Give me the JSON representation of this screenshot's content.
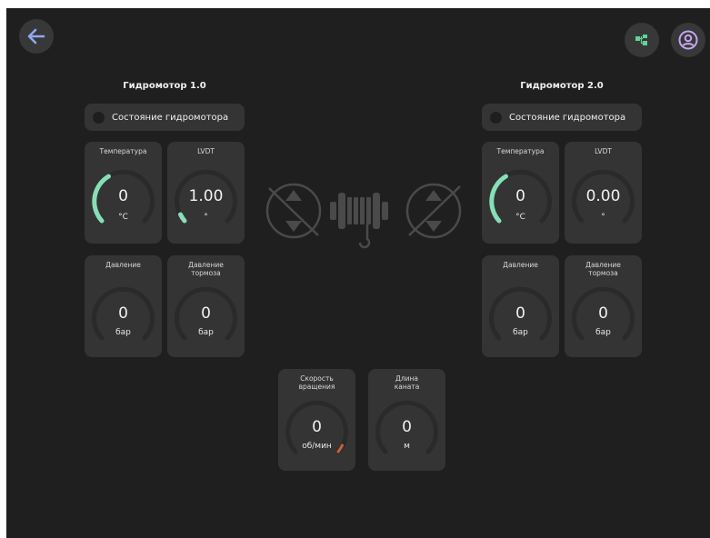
{
  "colors": {
    "background": "#1f1f1f",
    "card": "#343434",
    "gauge_track": "#2a2a2a",
    "gauge_green": "#86dfb6",
    "back_arrow": "#8fa8ee",
    "user_icon": "#c8a6ee",
    "tree_icon": "#5fd49a",
    "speed_marker": "#c8603a"
  },
  "header": {
    "back_icon": "arrow-left-icon",
    "tree_icon": "hierarchy-icon",
    "user_icon": "user-icon"
  },
  "motor1": {
    "title": "Гидромотор 1.0",
    "status_label": "Состояние гидромотора",
    "temperature": {
      "title": "Температура",
      "value": "0",
      "unit": "°C",
      "fill_fraction": 0.33
    },
    "lvdt": {
      "title": "LVDT",
      "value": "1.00",
      "unit": "°",
      "fill_fraction": 0.1
    },
    "pressure": {
      "title": "Давление",
      "value": "0",
      "unit": "бар"
    },
    "brake_pressure": {
      "title": "Давление\nтормоза",
      "value": "0",
      "unit": "бар"
    }
  },
  "motor2": {
    "title": "Гидромотор 2.0",
    "status_label": "Состояние гидромотора",
    "temperature": {
      "title": "Температура",
      "value": "0",
      "unit": "°C",
      "fill_fraction": 0.33
    },
    "lvdt": {
      "title": "LVDT",
      "value": "0.00",
      "unit": "°"
    },
    "pressure": {
      "title": "Давление",
      "value": "0",
      "unit": "бар"
    },
    "brake_pressure": {
      "title": "Давление\nтормоза",
      "value": "0",
      "unit": "бар"
    }
  },
  "center": {
    "speed": {
      "title": "Скорость\nвращения",
      "value": "0",
      "unit": "об/мин"
    },
    "rope_length": {
      "title": "Длина\nканата",
      "value": "0",
      "unit": "м"
    }
  }
}
